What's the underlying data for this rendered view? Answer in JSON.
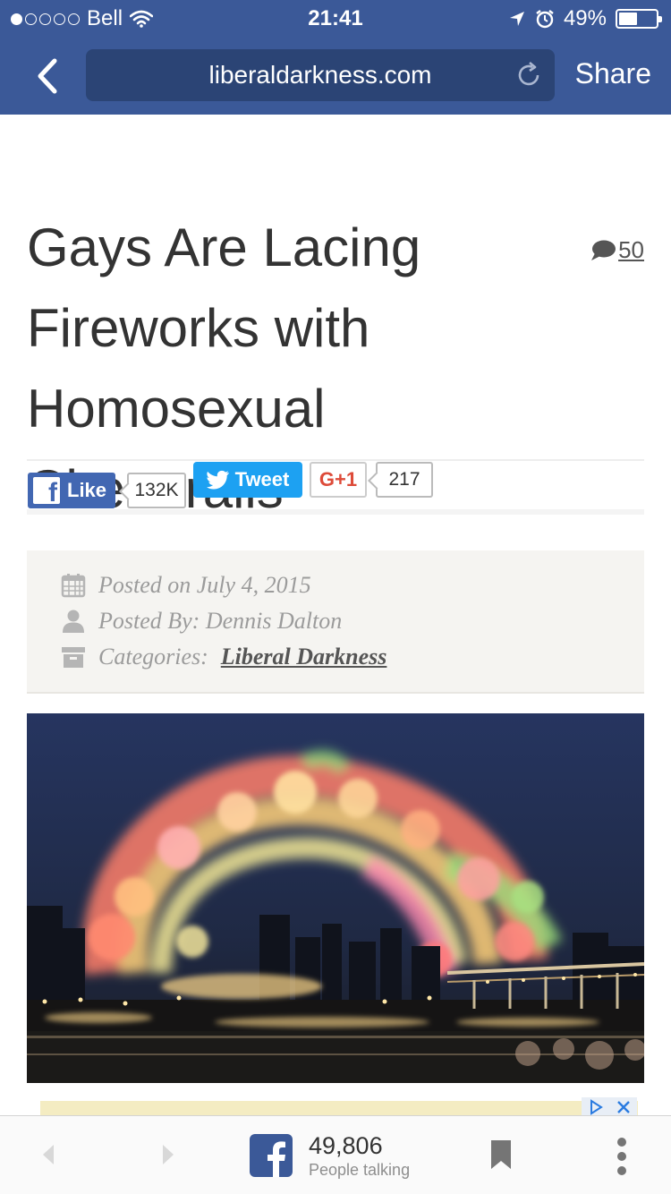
{
  "status_bar": {
    "carrier": "Bell",
    "time": "21:41",
    "battery_percent": "49%",
    "battery_level": 0.49,
    "signal_bars_filled": 1
  },
  "browser": {
    "back_icon": "chevron-left-icon",
    "url": "liberaldarkness.com",
    "reload_icon": "reload-icon",
    "share_label": "Share"
  },
  "article": {
    "title_lines": [
      "Gays Are Lacing",
      "Fireworks with",
      "Homosexual Chemtrails"
    ],
    "comment_count": "50"
  },
  "share_buttons": {
    "fb_like_label": "Like",
    "fb_like_count": "132K",
    "tweet_label": "Tweet",
    "gplus_label": "G+1",
    "gplus_count": "217"
  },
  "meta": {
    "posted_on": "Posted on July 4, 2015",
    "posted_by": "Posted By: Dennis Dalton",
    "categories_label": "Categories:",
    "category": "Liberal Darkness"
  },
  "toolbar": {
    "people_count": "49,806",
    "people_label": "People talking"
  },
  "colors": {
    "chrome_bg": "#3b5998",
    "url_bg": "#2b4475",
    "fb_blue": "#4267b2",
    "twitter_blue": "#1da1f2",
    "gplus_red": "#dd4b39",
    "meta_bg": "#f5f4f1"
  }
}
